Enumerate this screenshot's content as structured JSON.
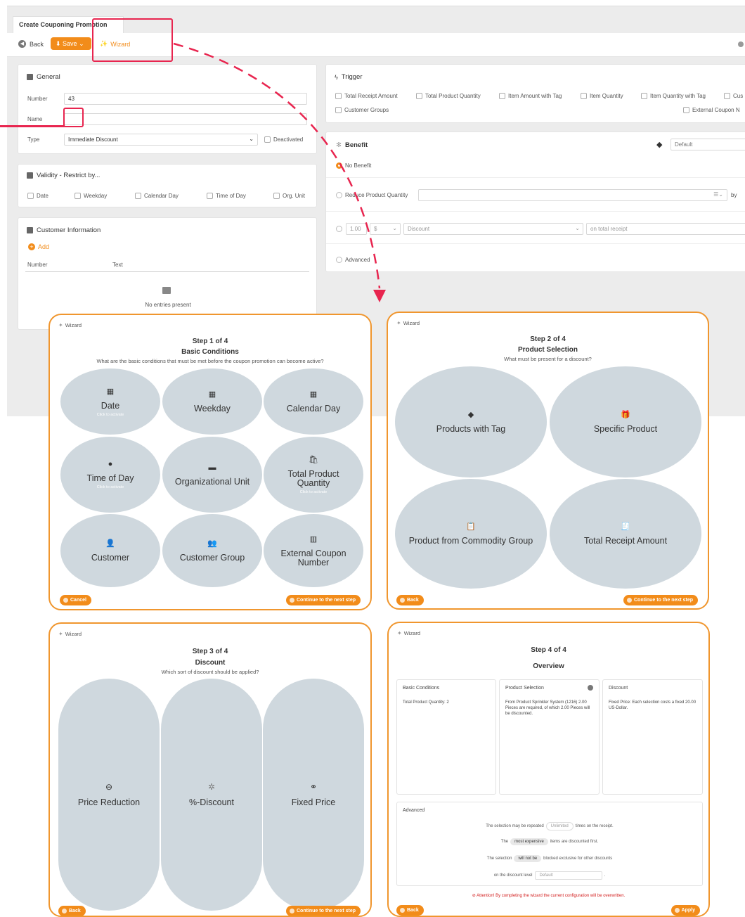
{
  "app": {
    "tab_title": "Create Couponing Promotion",
    "toolbar": {
      "back": "Back",
      "save": "Save",
      "wizard": "Wizard"
    },
    "general": {
      "title": "General",
      "number_label": "Number",
      "number_value": "43",
      "name_label": "Name",
      "type_label": "Type",
      "type_value": "Immediate Discount",
      "deactivated": "Deactivated"
    },
    "validity": {
      "title": "Validity - Restrict by...",
      "options": [
        "Date",
        "Weekday",
        "Calendar Day",
        "Time of Day",
        "Org. Unit"
      ]
    },
    "customer": {
      "title": "Customer Information",
      "add": "Add",
      "col_number": "Number",
      "col_text": "Text",
      "empty": "No entries present"
    },
    "trigger": {
      "title": "Trigger",
      "options": [
        "Total Receipt Amount",
        "Total Product Quantity",
        "Item Amount with Tag",
        "Item Quantity",
        "Item Quantity with Tag",
        "Cus"
      ],
      "customer_groups": "Customer Groups",
      "external": "External Coupon N"
    },
    "benefit": {
      "title": "Benefit",
      "level": "Default",
      "no_benefit": "No Benefit",
      "reduce": "Reduce Product Quantity",
      "by": "by",
      "amount": "1.00",
      "currency": "$",
      "discount": "Discount",
      "on_total": "on total receipt",
      "advanced": "Advanced"
    }
  },
  "wizard_label": "Wizard",
  "step1": {
    "step": "Step 1 of 4",
    "title": "Basic Conditions",
    "question": "What are the basic conditions that must be met before the coupon promotion can become active?",
    "hint": "Click to activate",
    "items": [
      "Date",
      "Weekday",
      "Calendar Day",
      "Time of Day",
      "Organizational Unit",
      "Total Product Quantity",
      "Customer",
      "Customer Group",
      "External Coupon Number"
    ],
    "cancel": "Cancel",
    "next": "Continue to the next step"
  },
  "step2": {
    "step": "Step 2 of 4",
    "title": "Product Selection",
    "question": "What must be present for a discount?",
    "items": [
      "Products with Tag",
      "Specific Product",
      "Product from Commodity Group",
      "Total Receipt Amount"
    ],
    "back": "Back",
    "next": "Continue to the next step"
  },
  "step3": {
    "step": "Step 3 of 4",
    "title": "Discount",
    "question": "Which sort of discount should be applied?",
    "items": [
      "Price Reduction",
      "%-Discount",
      "Fixed Price"
    ],
    "back": "Back",
    "next": "Continue to the next step"
  },
  "step4": {
    "step": "Step 4 of 4",
    "title": "Overview",
    "basic_title": "Basic Conditions",
    "basic_text": "Total Product Quantity: 2",
    "product_title": "Product Selection",
    "product_text": "From Product Sprinkler System (1216) 2.00 Pieces are required, of which 2.00 Pieces will be discounted.",
    "discount_title": "Discount",
    "discount_text": "Fixed Price: Each selection costs a fixed 20.00 US-Dollar.",
    "advanced": "Advanced",
    "row1_pre": "The selection may be repeated",
    "row1_val": "Unlimited",
    "row1_post": "times on the receipt.",
    "row2_pre": "The",
    "row2_val": "most expensive",
    "row2_post": "items are discounted first.",
    "row3_pre": "The selection",
    "row3_val": "will not be",
    "row3_post": "blocked exclusive for other discounts",
    "row4_pre": "on the discount level",
    "row4_val": "Default",
    "warning": "Attention! By completing the wizard the current configuration will be overwritten.",
    "back": "Back",
    "apply": "Apply"
  },
  "colors": {
    "accent": "#f28c1a",
    "highlight": "#e8254f",
    "bubble": "#cfd8de",
    "card_border": "#f0962e"
  }
}
